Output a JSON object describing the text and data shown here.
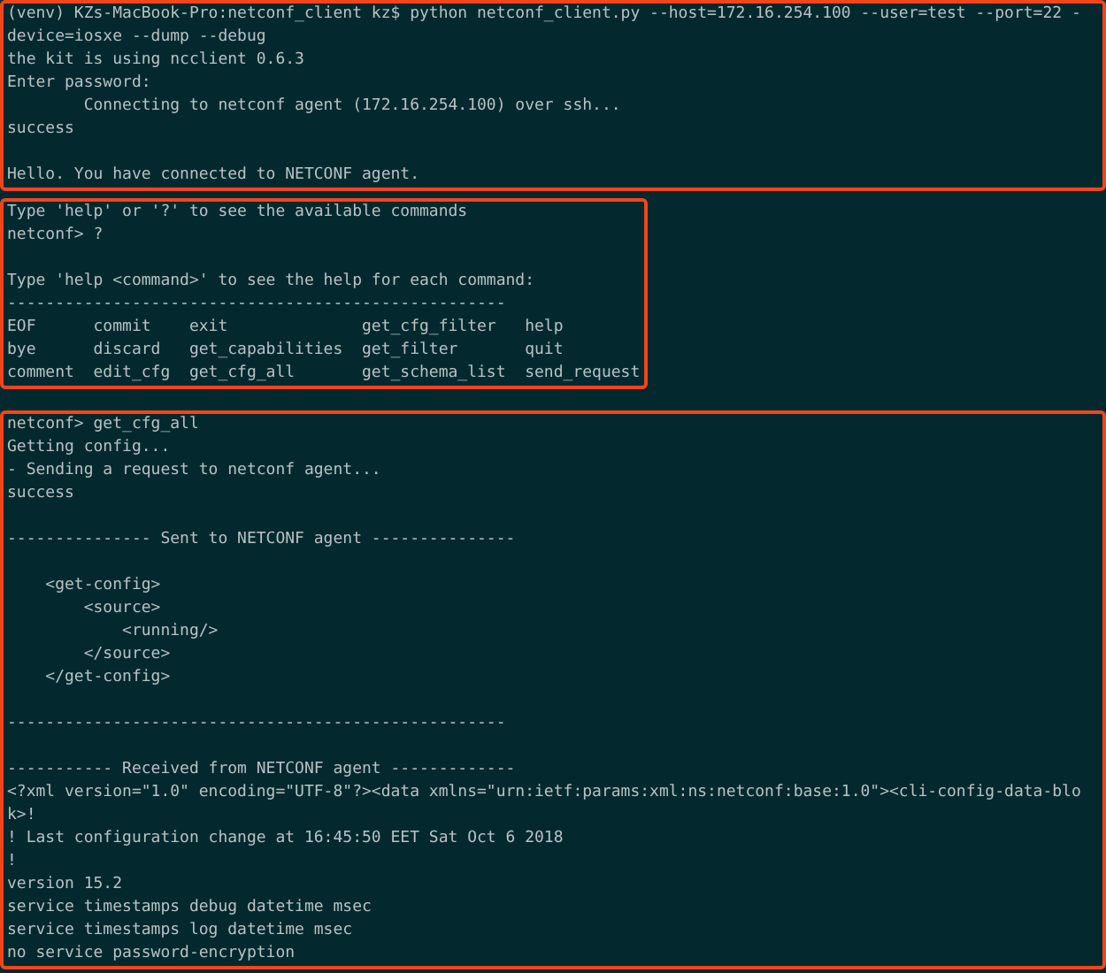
{
  "terminal": {
    "sections": [
      {
        "highlighted": true,
        "paragraphs": [
          [
            "(venv) KZs-MacBook-Pro:netconf_client kz$ python netconf_client.py --host=172.16.254.100 --user=test --port=22 -",
            "device=iosxe --dump --debug",
            "the kit is using ncclient 0.6.3",
            "Enter password:",
            "        Connecting to netconf agent (172.16.254.100) over ssh...",
            "success"
          ],
          [
            "Hello. You have connected to NETCONF agent."
          ]
        ]
      },
      {
        "highlighted": true,
        "paragraphs": [
          [
            "Type 'help' or '?' to see the available commands",
            "netconf> ?"
          ],
          [
            "Type 'help <command>' to see the help for each command:",
            "----------------------------------------------------",
            "EOF      commit    exit              get_cfg_filter   help",
            "bye      discard   get_capabilities  get_filter       quit",
            "comment  edit_cfg  get_cfg_all       get_schema_list  send_request"
          ]
        ]
      },
      {
        "highlighted": true,
        "paragraphs": [
          [
            "netconf> get_cfg_all",
            "Getting config...",
            "- Sending a request to netconf agent...",
            "success"
          ],
          [
            "--------------- Sent to NETCONF agent ---------------"
          ],
          [
            "    <get-config>",
            "        <source>",
            "            <running/>",
            "        </source>",
            "    </get-config>"
          ],
          [
            "----------------------------------------------------"
          ],
          [
            "----------- Received from NETCONF agent -------------",
            "<?xml version=\"1.0\" encoding=\"UTF-8\"?><data xmlns=\"urn:ietf:params:xml:ns:netconf:base:1.0\"><cli-config-data-blo",
            "k>!",
            "! Last configuration change at 16:45:50 EET Sat Oct 6 2018",
            "!",
            "version 15.2",
            "service timestamps debug datetime msec",
            "service timestamps log datetime msec",
            "no service password-encryption"
          ]
        ]
      }
    ]
  }
}
